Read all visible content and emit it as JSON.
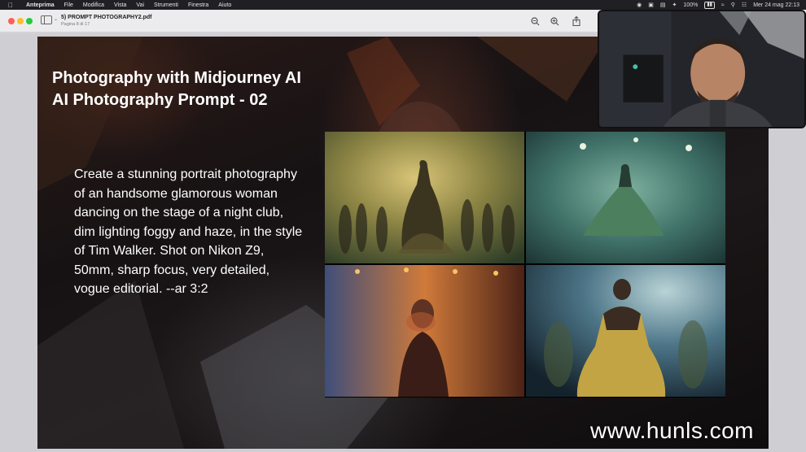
{
  "menubar": {
    "app_name": "Anteprima",
    "items": [
      "File",
      "Modifica",
      "Vista",
      "Vai",
      "Strumenti",
      "Finestra",
      "Aiuto"
    ],
    "battery": "100%",
    "datetime": "Mer 24 mag  22:13"
  },
  "toolbar": {
    "title": "5) PROMPT PHOTOGRAPHY2.pdf",
    "subtitle": "Pagina 8 di 17"
  },
  "slide": {
    "title_line1": "Photography with Midjourney AI",
    "title_line2": "AI Photography Prompt - 02",
    "prompt": "Create a stunning portrait photography of an handsome glamorous woman dancing on the stage of a night club, dim lighting foggy and haze, in the style of Tim Walker. Shot on Nikon Z9, 50mm, sharp focus, very detailed, vogue editorial. --ar 3:2"
  },
  "watermark": "www.hunls.com",
  "icons": {
    "apple": "apple-icon",
    "zoom_out": "zoom-out-icon",
    "zoom_in": "zoom-in-icon",
    "share": "share-icon",
    "sidebar": "sidebar-toggle-icon"
  },
  "colors": {
    "close": "#ff5f57",
    "minimize": "#febc2e",
    "zoom": "#28c840"
  }
}
